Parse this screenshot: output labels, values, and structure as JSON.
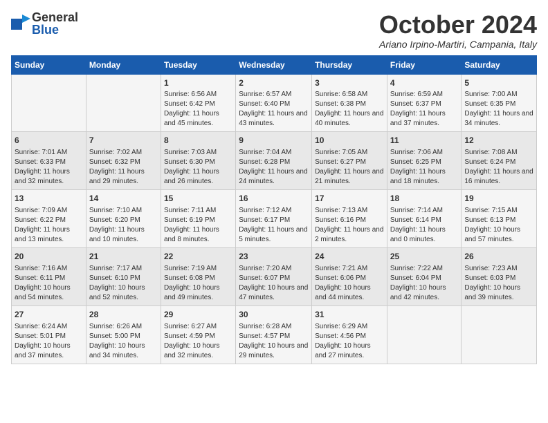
{
  "header": {
    "logo_line1": "General",
    "logo_line2": "Blue",
    "month_title": "October 2024",
    "location": "Ariano Irpino-Martiri, Campania, Italy"
  },
  "columns": [
    "Sunday",
    "Monday",
    "Tuesday",
    "Wednesday",
    "Thursday",
    "Friday",
    "Saturday"
  ],
  "rows": [
    [
      {
        "day": "",
        "info": ""
      },
      {
        "day": "",
        "info": ""
      },
      {
        "day": "1",
        "info": "Sunrise: 6:56 AM\nSunset: 6:42 PM\nDaylight: 11 hours and 45 minutes."
      },
      {
        "day": "2",
        "info": "Sunrise: 6:57 AM\nSunset: 6:40 PM\nDaylight: 11 hours and 43 minutes."
      },
      {
        "day": "3",
        "info": "Sunrise: 6:58 AM\nSunset: 6:38 PM\nDaylight: 11 hours and 40 minutes."
      },
      {
        "day": "4",
        "info": "Sunrise: 6:59 AM\nSunset: 6:37 PM\nDaylight: 11 hours and 37 minutes."
      },
      {
        "day": "5",
        "info": "Sunrise: 7:00 AM\nSunset: 6:35 PM\nDaylight: 11 hours and 34 minutes."
      }
    ],
    [
      {
        "day": "6",
        "info": "Sunrise: 7:01 AM\nSunset: 6:33 PM\nDaylight: 11 hours and 32 minutes."
      },
      {
        "day": "7",
        "info": "Sunrise: 7:02 AM\nSunset: 6:32 PM\nDaylight: 11 hours and 29 minutes."
      },
      {
        "day": "8",
        "info": "Sunrise: 7:03 AM\nSunset: 6:30 PM\nDaylight: 11 hours and 26 minutes."
      },
      {
        "day": "9",
        "info": "Sunrise: 7:04 AM\nSunset: 6:28 PM\nDaylight: 11 hours and 24 minutes."
      },
      {
        "day": "10",
        "info": "Sunrise: 7:05 AM\nSunset: 6:27 PM\nDaylight: 11 hours and 21 minutes."
      },
      {
        "day": "11",
        "info": "Sunrise: 7:06 AM\nSunset: 6:25 PM\nDaylight: 11 hours and 18 minutes."
      },
      {
        "day": "12",
        "info": "Sunrise: 7:08 AM\nSunset: 6:24 PM\nDaylight: 11 hours and 16 minutes."
      }
    ],
    [
      {
        "day": "13",
        "info": "Sunrise: 7:09 AM\nSunset: 6:22 PM\nDaylight: 11 hours and 13 minutes."
      },
      {
        "day": "14",
        "info": "Sunrise: 7:10 AM\nSunset: 6:20 PM\nDaylight: 11 hours and 10 minutes."
      },
      {
        "day": "15",
        "info": "Sunrise: 7:11 AM\nSunset: 6:19 PM\nDaylight: 11 hours and 8 minutes."
      },
      {
        "day": "16",
        "info": "Sunrise: 7:12 AM\nSunset: 6:17 PM\nDaylight: 11 hours and 5 minutes."
      },
      {
        "day": "17",
        "info": "Sunrise: 7:13 AM\nSunset: 6:16 PM\nDaylight: 11 hours and 2 minutes."
      },
      {
        "day": "18",
        "info": "Sunrise: 7:14 AM\nSunset: 6:14 PM\nDaylight: 11 hours and 0 minutes."
      },
      {
        "day": "19",
        "info": "Sunrise: 7:15 AM\nSunset: 6:13 PM\nDaylight: 10 hours and 57 minutes."
      }
    ],
    [
      {
        "day": "20",
        "info": "Sunrise: 7:16 AM\nSunset: 6:11 PM\nDaylight: 10 hours and 54 minutes."
      },
      {
        "day": "21",
        "info": "Sunrise: 7:17 AM\nSunset: 6:10 PM\nDaylight: 10 hours and 52 minutes."
      },
      {
        "day": "22",
        "info": "Sunrise: 7:19 AM\nSunset: 6:08 PM\nDaylight: 10 hours and 49 minutes."
      },
      {
        "day": "23",
        "info": "Sunrise: 7:20 AM\nSunset: 6:07 PM\nDaylight: 10 hours and 47 minutes."
      },
      {
        "day": "24",
        "info": "Sunrise: 7:21 AM\nSunset: 6:06 PM\nDaylight: 10 hours and 44 minutes."
      },
      {
        "day": "25",
        "info": "Sunrise: 7:22 AM\nSunset: 6:04 PM\nDaylight: 10 hours and 42 minutes."
      },
      {
        "day": "26",
        "info": "Sunrise: 7:23 AM\nSunset: 6:03 PM\nDaylight: 10 hours and 39 minutes."
      }
    ],
    [
      {
        "day": "27",
        "info": "Sunrise: 6:24 AM\nSunset: 5:01 PM\nDaylight: 10 hours and 37 minutes."
      },
      {
        "day": "28",
        "info": "Sunrise: 6:26 AM\nSunset: 5:00 PM\nDaylight: 10 hours and 34 minutes."
      },
      {
        "day": "29",
        "info": "Sunrise: 6:27 AM\nSunset: 4:59 PM\nDaylight: 10 hours and 32 minutes."
      },
      {
        "day": "30",
        "info": "Sunrise: 6:28 AM\nSunset: 4:57 PM\nDaylight: 10 hours and 29 minutes."
      },
      {
        "day": "31",
        "info": "Sunrise: 6:29 AM\nSunset: 4:56 PM\nDaylight: 10 hours and 27 minutes."
      },
      {
        "day": "",
        "info": ""
      },
      {
        "day": "",
        "info": ""
      }
    ]
  ]
}
